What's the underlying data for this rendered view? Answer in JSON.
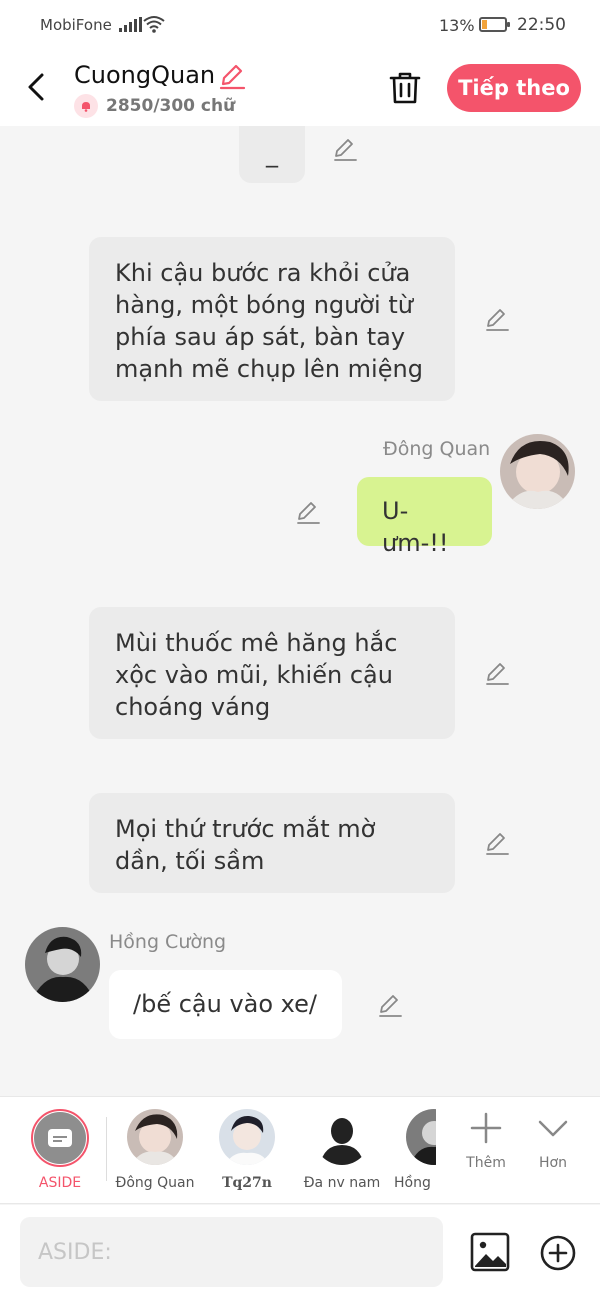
{
  "status_bar": {
    "carrier": "MobiFone",
    "battery": "13%",
    "time": "22:50"
  },
  "header": {
    "title": "CuongQuan",
    "word_count": "2850/300 chữ",
    "next_label": "Tiếp theo"
  },
  "messages": {
    "partial": "_",
    "narr1": "Khi cậu bước ra khỏi cửa hàng, một bóng người từ phía sau áp sát, bàn tay mạnh mẽ chụp lên miệng",
    "dong_name": "Đông Quan",
    "dong_text": "U-ưm-!!",
    "narr2": "Mùi thuốc mê hăng hắc xộc vào mũi, khiến cậu choáng váng",
    "narr3": "Mọi thứ trước mắt mờ dần, tối sầm",
    "hong_name": "Hồng Cường",
    "hong_text": "/bế cậu vào xe/"
  },
  "characters": [
    {
      "label": "ASIDE"
    },
    {
      "label": "Đông Quan"
    },
    {
      "label": "Tq27n"
    },
    {
      "label": "Đa nv nam"
    },
    {
      "label": "Hồng"
    }
  ],
  "tools": {
    "add_label": "Thêm",
    "more_label": "Hơn"
  },
  "input": {
    "placeholder": "ASIDE:"
  },
  "colors": {
    "accent": "#f4546b",
    "green_bubble": "#d8f391",
    "narration_bg": "#ebebeb"
  }
}
